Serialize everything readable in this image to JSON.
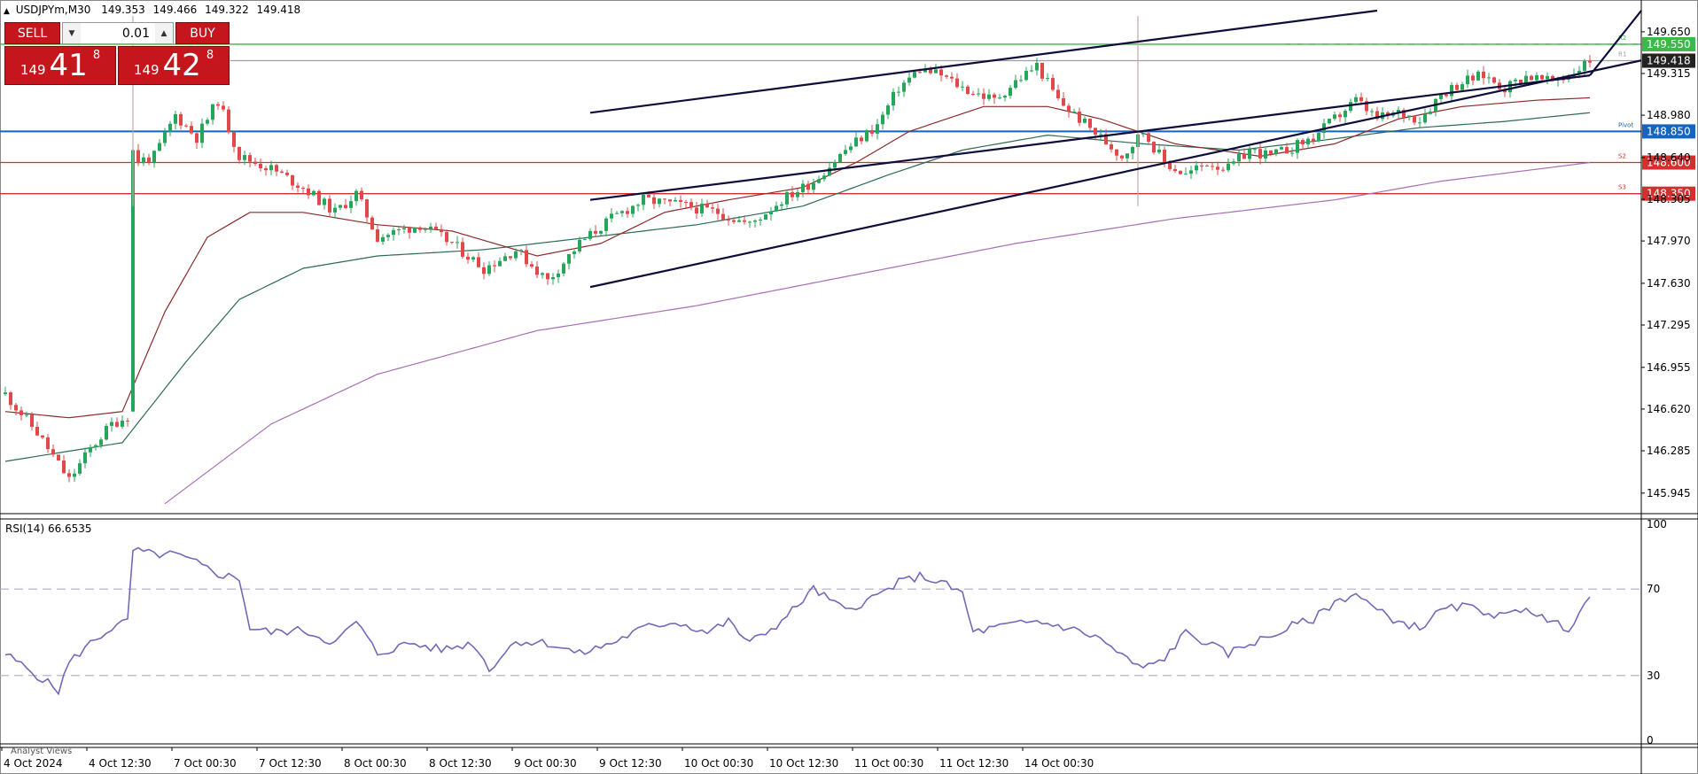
{
  "header": {
    "symbol": "USDJPYm,M30",
    "open": "149.353",
    "high": "149.466",
    "low": "149.322",
    "close": "149.418"
  },
  "trade_panel": {
    "sell_label": "SELL",
    "buy_label": "BUY",
    "lot_value": "0.01",
    "sell_price_prefix": "149",
    "sell_price_big": "41",
    "sell_price_sup": "8",
    "buy_price_prefix": "149",
    "buy_price_big": "42",
    "buy_price_sup": "8"
  },
  "colors": {
    "bull": "#26a65b",
    "bear": "#e0484a",
    "pivot": "#1565c0",
    "support": "#d32f2f",
    "r2": "#3cb94a",
    "ma_fast": "#8b2a2a",
    "ma_mid": "#2e6b55",
    "ma_slow": "#a96fb5",
    "rsi": "#6f6bb8",
    "channel": "#0d0d3a"
  },
  "icons": {
    "collapse": "triangle-up-icon",
    "lot_down": "chevron-down-icon",
    "lot_up": "chevron-up-icon"
  },
  "bottom_label": "Analyst Views",
  "chart_data": [
    {
      "type": "candlestick",
      "title": "USDJPYm,M30",
      "ylim": [
        145.78,
        149.82
      ],
      "y_ticks": [
        "149.650",
        "149.315",
        "148.980",
        "148.640",
        "148.305",
        "147.970",
        "147.630",
        "147.295",
        "146.955",
        "146.620",
        "146.285",
        "145.945"
      ],
      "x_ticks": [
        "4 Oct 2024",
        "4 Oct 12:30",
        "7 Oct 00:30",
        "7 Oct 12:30",
        "8 Oct 00:30",
        "8 Oct 12:30",
        "9 Oct 00:30",
        "9 Oct 12:30",
        "10 Oct 00:30",
        "10 Oct 12:30",
        "11 Oct 00:30",
        "11 Oct 12:30",
        "14 Oct 00:30"
      ],
      "current_price": "149.418",
      "levels": [
        {
          "name": "R2",
          "value": "149.550"
        },
        {
          "name": "R1",
          "value": "149.418"
        },
        {
          "name": "Pivot",
          "value": "148.850"
        },
        {
          "name": "S2",
          "value": "148.600"
        },
        {
          "name": "S3",
          "value": "148.350"
        }
      ],
      "level_values": [
        149.55,
        149.418,
        148.85,
        148.6,
        148.35
      ],
      "level_tags": [
        "R2",
        "R1",
        "Pivot",
        "S2",
        "S3"
      ],
      "close_waypoints": [
        [
          0,
          146.74
        ],
        [
          6,
          146.43
        ],
        [
          12,
          146.05
        ],
        [
          16,
          146.3
        ],
        [
          20,
          146.5
        ],
        [
          23,
          146.56
        ],
        [
          24,
          148.6
        ],
        [
          28,
          148.65
        ],
        [
          32,
          148.98
        ],
        [
          36,
          148.8
        ],
        [
          40,
          149.1
        ],
        [
          44,
          148.65
        ],
        [
          50,
          148.55
        ],
        [
          56,
          148.4
        ],
        [
          62,
          148.2
        ],
        [
          66,
          148.35
        ],
        [
          70,
          148.0
        ],
        [
          78,
          148.1
        ],
        [
          84,
          147.95
        ],
        [
          90,
          147.75
        ],
        [
          96,
          147.9
        ],
        [
          102,
          147.65
        ],
        [
          108,
          147.95
        ],
        [
          114,
          148.15
        ],
        [
          120,
          148.3
        ],
        [
          128,
          148.25
        ],
        [
          134,
          148.2
        ],
        [
          140,
          148.1
        ],
        [
          146,
          148.3
        ],
        [
          152,
          148.45
        ],
        [
          158,
          148.7
        ],
        [
          164,
          148.9
        ],
        [
          168,
          149.2
        ],
        [
          172,
          149.35
        ],
        [
          176,
          149.3
        ],
        [
          180,
          149.2
        ],
        [
          186,
          149.1
        ],
        [
          190,
          149.25
        ],
        [
          194,
          149.38
        ],
        [
          198,
          149.1
        ],
        [
          202,
          148.95
        ],
        [
          206,
          148.8
        ],
        [
          210,
          148.65
        ],
        [
          214,
          148.85
        ],
        [
          218,
          148.6
        ],
        [
          222,
          148.5
        ],
        [
          226,
          148.6
        ],
        [
          230,
          148.55
        ],
        [
          234,
          148.7
        ],
        [
          238,
          148.65
        ],
        [
          242,
          148.72
        ],
        [
          246,
          148.8
        ],
        [
          250,
          148.95
        ],
        [
          254,
          149.1
        ],
        [
          258,
          148.95
        ],
        [
          262,
          149.0
        ],
        [
          266,
          148.95
        ],
        [
          270,
          149.15
        ],
        [
          274,
          149.25
        ],
        [
          278,
          149.3
        ],
        [
          282,
          149.2
        ],
        [
          286,
          149.3
        ],
        [
          290,
          149.25
        ],
        [
          294,
          149.3
        ],
        [
          298,
          149.42
        ]
      ],
      "ma_slow": [
        [
          30,
          145.86
        ],
        [
          50,
          146.5
        ],
        [
          70,
          146.9
        ],
        [
          100,
          147.25
        ],
        [
          130,
          147.45
        ],
        [
          160,
          147.7
        ],
        [
          190,
          147.95
        ],
        [
          220,
          148.15
        ],
        [
          250,
          148.3
        ],
        [
          270,
          148.45
        ],
        [
          298,
          148.6
        ]
      ],
      "ma_mid": [
        [
          0,
          146.2
        ],
        [
          22,
          146.35
        ],
        [
          34,
          147.0
        ],
        [
          44,
          147.5
        ],
        [
          56,
          147.75
        ],
        [
          70,
          147.85
        ],
        [
          90,
          147.9
        ],
        [
          110,
          148.0
        ],
        [
          130,
          148.1
        ],
        [
          150,
          148.25
        ],
        [
          166,
          148.5
        ],
        [
          180,
          148.7
        ],
        [
          196,
          148.82
        ],
        [
          214,
          148.75
        ],
        [
          232,
          148.7
        ],
        [
          248,
          148.78
        ],
        [
          266,
          148.88
        ],
        [
          282,
          148.93
        ],
        [
          298,
          149.0
        ]
      ],
      "ma_fast": [
        [
          0,
          146.6
        ],
        [
          12,
          146.55
        ],
        [
          22,
          146.6
        ],
        [
          30,
          147.4
        ],
        [
          38,
          148.0
        ],
        [
          46,
          148.2
        ],
        [
          56,
          148.2
        ],
        [
          70,
          148.1
        ],
        [
          84,
          148.05
        ],
        [
          100,
          147.85
        ],
        [
          112,
          147.95
        ],
        [
          124,
          148.2
        ],
        [
          136,
          148.3
        ],
        [
          150,
          148.4
        ],
        [
          160,
          148.6
        ],
        [
          170,
          148.85
        ],
        [
          184,
          149.05
        ],
        [
          196,
          149.05
        ],
        [
          206,
          148.95
        ],
        [
          220,
          148.75
        ],
        [
          236,
          148.65
        ],
        [
          250,
          148.75
        ],
        [
          262,
          148.95
        ],
        [
          274,
          149.05
        ],
        [
          288,
          149.1
        ],
        [
          298,
          149.12
        ]
      ],
      "channel_lines": [
        {
          "from": [
            110,
            149.0
          ],
          "to": [
            258,
            149.82
          ]
        },
        {
          "from": [
            110,
            148.3
          ],
          "to": [
            298,
            149.3
          ]
        },
        {
          "from": [
            110,
            147.6
          ],
          "to": [
            462,
            149.42
          ]
        },
        {
          "from": [
            298,
            149.3
          ],
          "to": [
            392,
            149.82
          ]
        }
      ],
      "vertical_markers": [
        24,
        213
      ]
    },
    {
      "type": "line",
      "title": "RSI(14) 66.6535",
      "ylim": [
        0,
        100
      ],
      "y_ticks": [
        "100",
        "70",
        "30",
        "0"
      ],
      "levels": [
        70,
        30
      ],
      "rsi_waypoints": [
        [
          0,
          40
        ],
        [
          6,
          30
        ],
        [
          10,
          23
        ],
        [
          12,
          36
        ],
        [
          16,
          45
        ],
        [
          20,
          52
        ],
        [
          23,
          55
        ],
        [
          24,
          88
        ],
        [
          28,
          86
        ],
        [
          32,
          86
        ],
        [
          36,
          82
        ],
        [
          40,
          77
        ],
        [
          44,
          75
        ],
        [
          46,
          52
        ],
        [
          50,
          50
        ],
        [
          56,
          51
        ],
        [
          62,
          45
        ],
        [
          66,
          55
        ],
        [
          70,
          40
        ],
        [
          76,
          45
        ],
        [
          82,
          42
        ],
        [
          88,
          45
        ],
        [
          91,
          33
        ],
        [
          96,
          46
        ],
        [
          102,
          45
        ],
        [
          108,
          40
        ],
        [
          114,
          45
        ],
        [
          120,
          52
        ],
        [
          126,
          55
        ],
        [
          132,
          50
        ],
        [
          136,
          55
        ],
        [
          140,
          45
        ],
        [
          146,
          55
        ],
        [
          152,
          70
        ],
        [
          158,
          60
        ],
        [
          164,
          67
        ],
        [
          168,
          73
        ],
        [
          172,
          76
        ],
        [
          176,
          73
        ],
        [
          180,
          68
        ],
        [
          182,
          50
        ],
        [
          188,
          53
        ],
        [
          194,
          55
        ],
        [
          200,
          52
        ],
        [
          206,
          47
        ],
        [
          210,
          39
        ],
        [
          214,
          33
        ],
        [
          218,
          38
        ],
        [
          222,
          50
        ],
        [
          226,
          45
        ],
        [
          230,
          40
        ],
        [
          234,
          45
        ],
        [
          238,
          48
        ],
        [
          242,
          53
        ],
        [
          246,
          56
        ],
        [
          250,
          64
        ],
        [
          254,
          68
        ],
        [
          258,
          60
        ],
        [
          262,
          55
        ],
        [
          266,
          52
        ],
        [
          270,
          60
        ],
        [
          274,
          62
        ],
        [
          278,
          60
        ],
        [
          282,
          57
        ],
        [
          286,
          62
        ],
        [
          290,
          55
        ],
        [
          294,
          52
        ],
        [
          298,
          66.65
        ]
      ]
    }
  ]
}
